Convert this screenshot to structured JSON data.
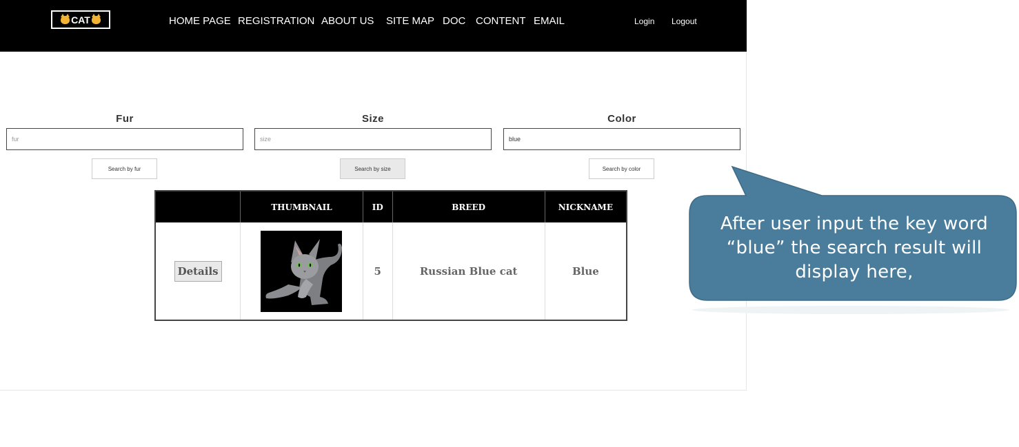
{
  "navbar": {
    "logo_text": "CAT",
    "logo_icon": "cat-face-icon",
    "links": [
      "HOME PAGE",
      "REGISTRATION",
      "ABOUT US",
      "SITE MAP",
      "DOC",
      "CONTENT",
      "EMAIL"
    ],
    "login": "Login",
    "logout": "Logout"
  },
  "filters": [
    {
      "label": "Fur",
      "placeholder": "fur",
      "value": "",
      "button": "Search by fur"
    },
    {
      "label": "Size",
      "placeholder": "size",
      "value": "",
      "button": "Search by size"
    },
    {
      "label": "Color",
      "placeholder": "color",
      "value": "blue",
      "button": "Search by color"
    }
  ],
  "table": {
    "headers": [
      "",
      "THUMBNAIL",
      "ID",
      "BREED",
      "NICKNAME"
    ],
    "rows": [
      {
        "details": "Details",
        "thumbnail": "russian-blue-cat-photo",
        "id": "5",
        "breed": "Russian Blue cat",
        "nickname": "Blue"
      }
    ]
  },
  "callout": {
    "lines": [
      "After user input the key word",
      "“blue” the search result will",
      "display here,"
    ],
    "color": "#4a7d9c"
  }
}
